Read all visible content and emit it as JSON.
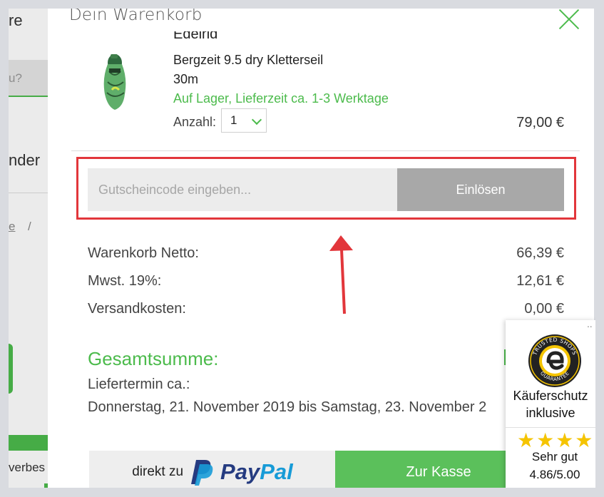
{
  "background_page": {
    "text_1": "re",
    "search_hint": "u?",
    "text_2": "nder",
    "breadcrumb_link": "e",
    "breadcrumb_sep": "/",
    "text_3": "verbes"
  },
  "drawer": {
    "title": "Dein Warenkorb",
    "item": {
      "brand": "Edelrid",
      "name": "Bergzeit 9.5 dry Kletterseil",
      "variant": "30m",
      "stock": "Auf Lager, Lieferzeit ca. 1-3 Werktage",
      "qty_label": "Anzahl:",
      "qty_value": "1",
      "price": "79,00 €"
    },
    "coupon": {
      "placeholder": "Gutscheincode eingeben...",
      "button": "Einlösen"
    },
    "summary": {
      "rows": [
        {
          "label": "Warenkorb Netto:",
          "value": "66,39 €"
        },
        {
          "label": "Mwst. 19%:",
          "value": "12,61 €"
        },
        {
          "label": "Versandkosten:",
          "value": "0,00 €"
        }
      ],
      "total_label": "Gesamtsumme:",
      "delivery_label": "Liefertermin ca.:",
      "delivery_dates": "Donnerstag, 21. November 2019 bis Samstag, 23. November 2"
    },
    "paypal": {
      "prefix": "direkt zu",
      "logo_pay": "Pay",
      "logo_pal": "Pal"
    },
    "checkout": {
      "label": "Zur Kasse"
    }
  },
  "trusted_shops": {
    "menu": "··",
    "seal_top": "TRUSTED SHOPS",
    "seal_bottom": "GUARANTEE",
    "line1": "Käuferschutz",
    "line2": "inklusive",
    "stars": "★★★★★",
    "rating_label": "Sehr gut",
    "score": "4.86/5.00"
  },
  "colors": {
    "accent_green": "#4cbb4c",
    "highlight_red": "#e2363b",
    "redeem_grey": "#a8a8a8"
  }
}
